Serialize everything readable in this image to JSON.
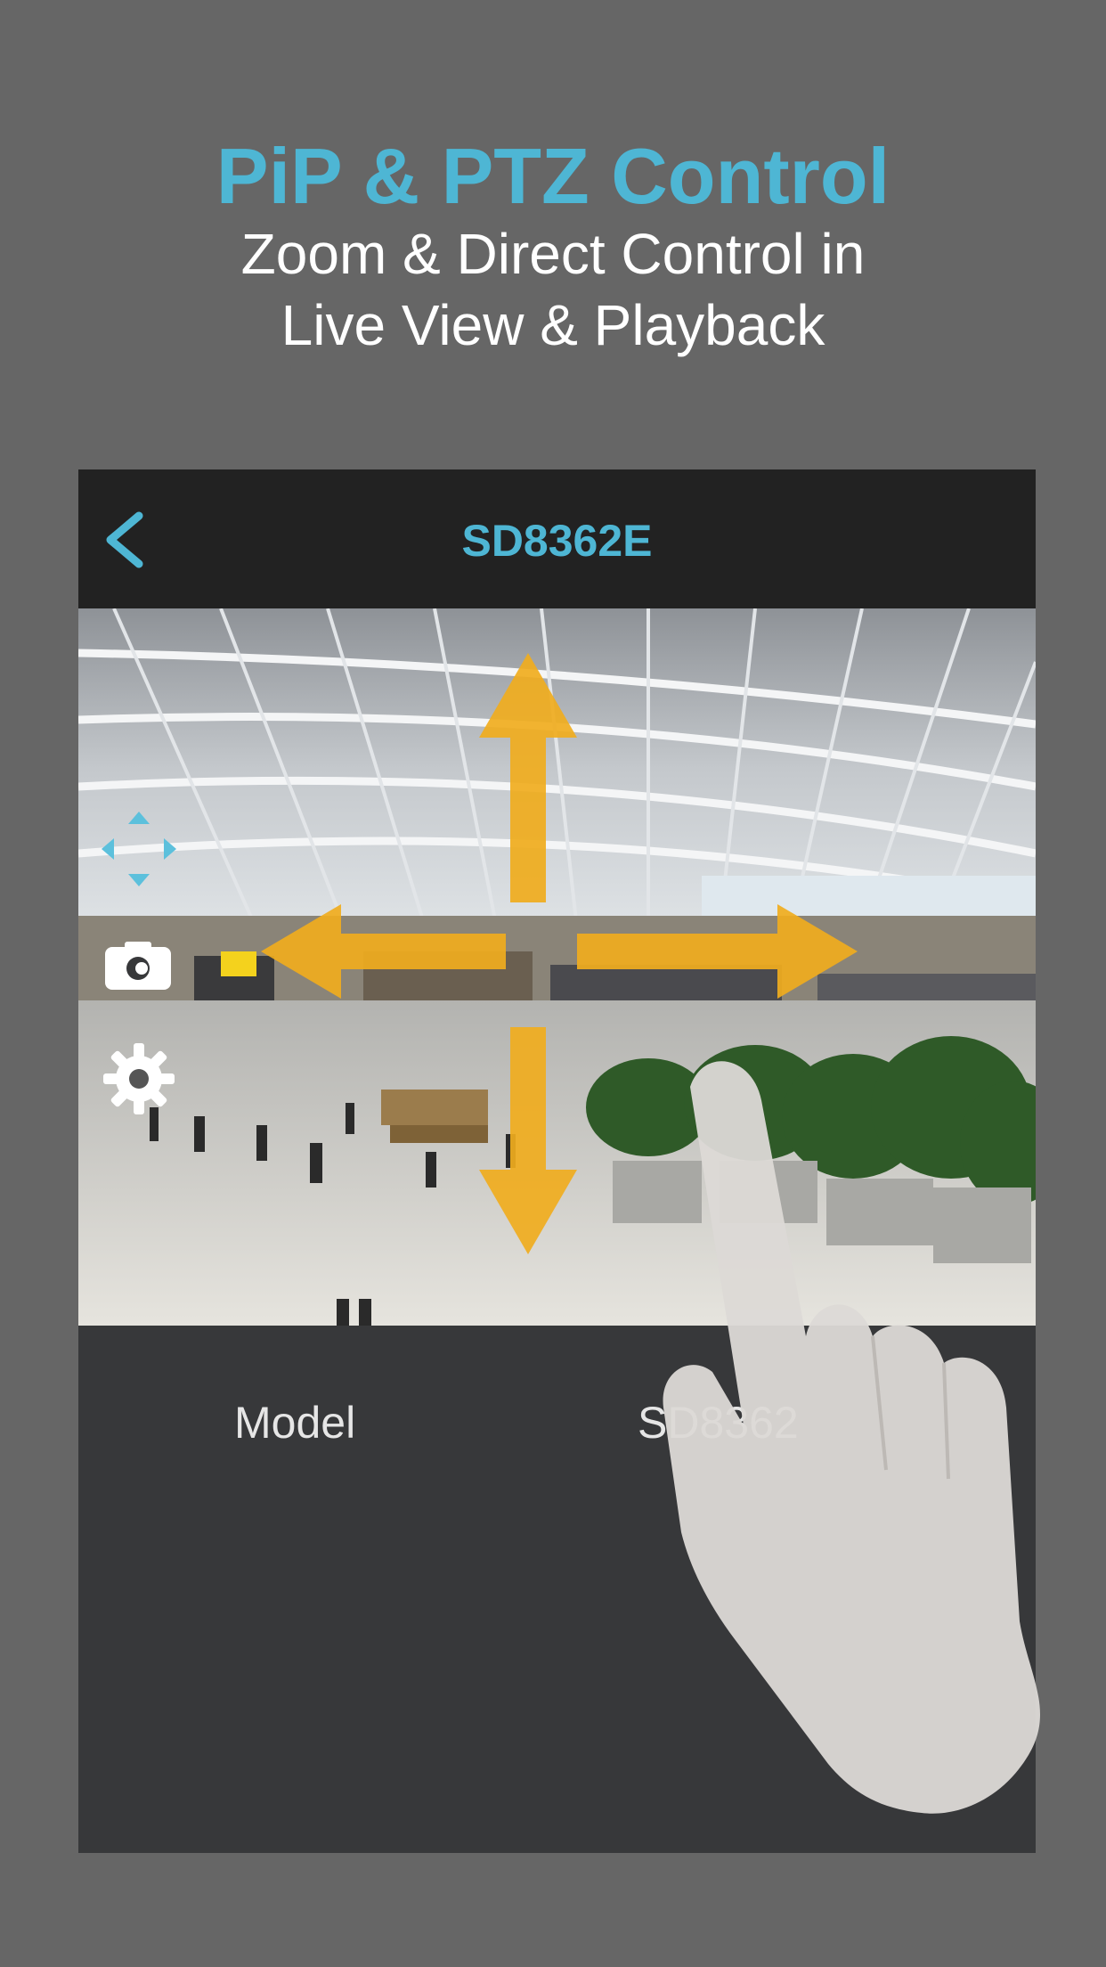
{
  "promo": {
    "headline": "PiP & PTZ Control",
    "subline_1": "Zoom & Direct Control in",
    "subline_2": "Live View & Playback"
  },
  "navbar": {
    "back_icon": "chevron-left-icon",
    "title": "SD8362E"
  },
  "live_view": {
    "scene": "airport-terminal-camera-feed",
    "controls": [
      "pip-toggle-icon",
      "snapshot-icon",
      "settings-icon"
    ],
    "ptz_directions": [
      "up",
      "down",
      "left",
      "right"
    ]
  },
  "info": {
    "model_label": "Model",
    "model_value": "SD8362"
  },
  "colors": {
    "background": "#666666",
    "accent": "#4eb6d4",
    "navbar": "#222222",
    "panel": "#37383a",
    "arrow": "#f0ad1e"
  }
}
